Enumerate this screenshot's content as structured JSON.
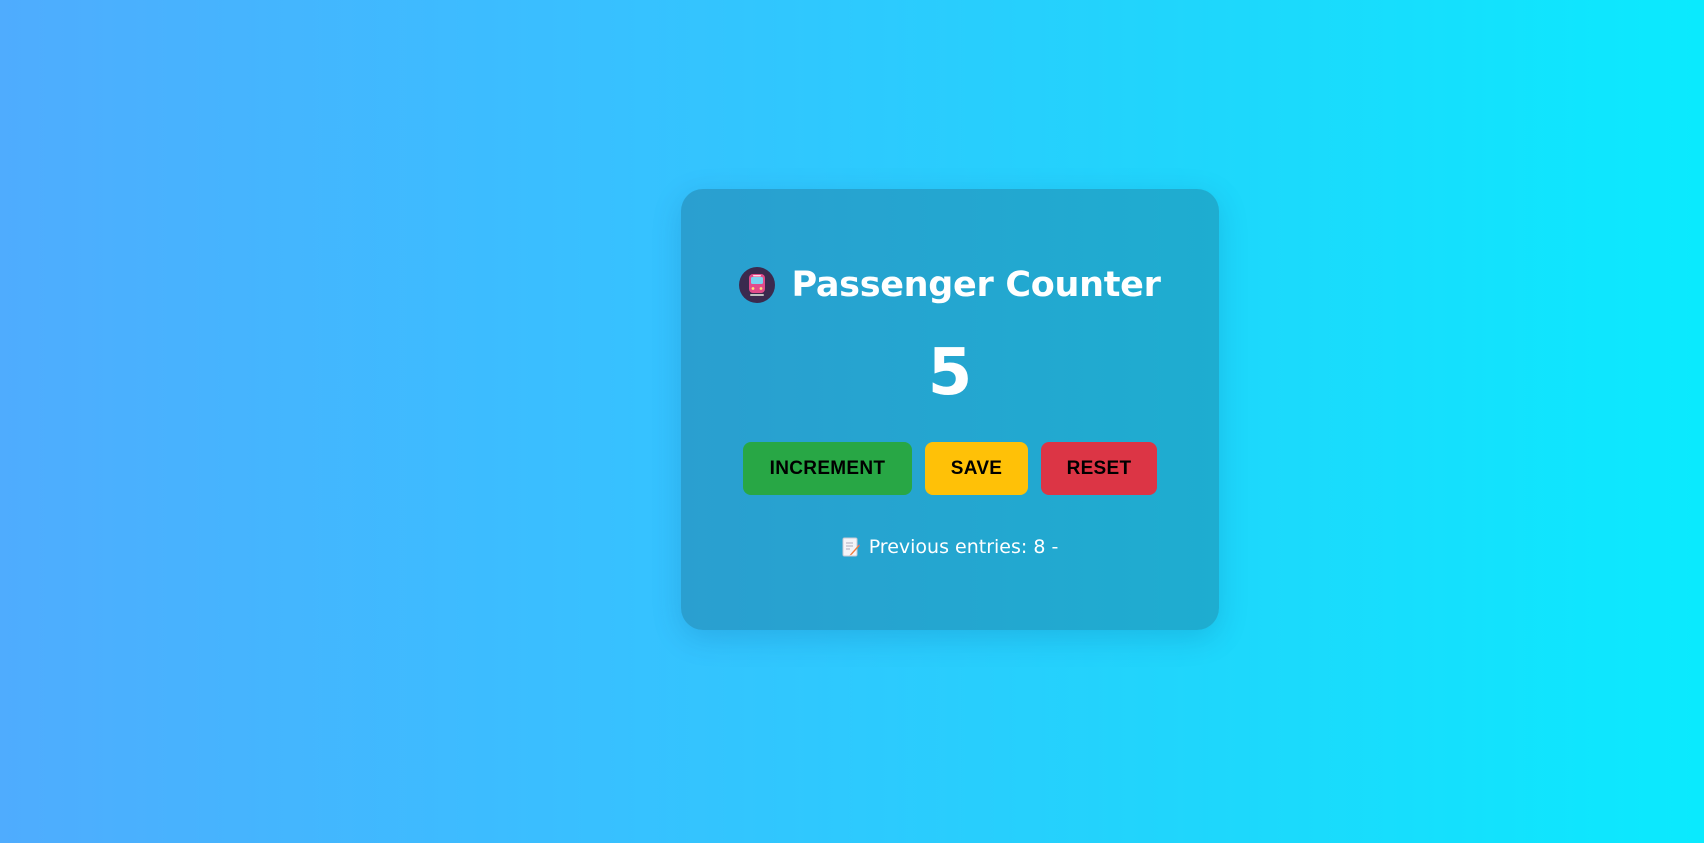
{
  "app": {
    "title": "Passenger Counter",
    "title_icon": "train-icon"
  },
  "counter": {
    "value": "5"
  },
  "buttons": {
    "increment_label": "INCREMENT",
    "save_label": "SAVE",
    "reset_label": "RESET"
  },
  "entries": {
    "icon": "memo-icon",
    "text": "Previous entries: 8 -"
  },
  "colors": {
    "increment": "#28a745",
    "save": "#ffc107",
    "reset": "#dc3545",
    "background_start": "#4facfe",
    "background_end": "#0aeafe"
  }
}
